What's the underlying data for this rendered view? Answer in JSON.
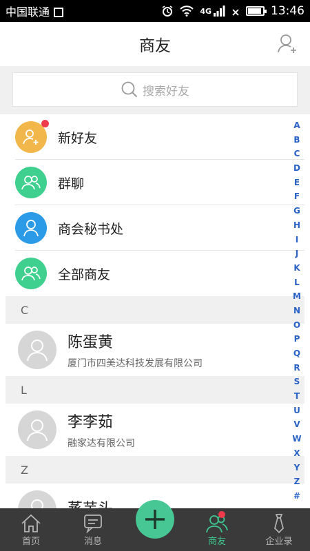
{
  "status_bar": {
    "carrier": "中国联通",
    "network": "4G",
    "time": "13:46"
  },
  "header": {
    "title": "商友"
  },
  "search": {
    "placeholder": "搜索好友"
  },
  "shortcuts": [
    {
      "label": "新好友",
      "color": "#f2b74a",
      "icon": "add-person-icon",
      "badge": true
    },
    {
      "label": "群聊",
      "color": "#3fd08f",
      "icon": "group-icon",
      "badge": false
    },
    {
      "label": "商会秘书处",
      "color": "#2b9be8",
      "icon": "person-icon",
      "badge": false
    },
    {
      "label": "全部商友",
      "color": "#3fd08f",
      "icon": "group-icon",
      "badge": false
    }
  ],
  "sections": [
    {
      "letter": "C",
      "contacts": [
        {
          "name": "陈蛋黄",
          "company": "厦门市四美达科技发展有限公司"
        }
      ]
    },
    {
      "letter": "L",
      "contacts": [
        {
          "name": "李李茹",
          "company": "融家达有限公司"
        }
      ]
    },
    {
      "letter": "Z",
      "contacts": [
        {
          "name": "蒸芋头",
          "company": ""
        }
      ]
    }
  ],
  "alphabet": [
    "A",
    "B",
    "C",
    "D",
    "E",
    "F",
    "G",
    "H",
    "I",
    "J",
    "K",
    "L",
    "M",
    "N",
    "O",
    "P",
    "Q",
    "R",
    "S",
    "T",
    "U",
    "V",
    "W",
    "X",
    "Y",
    "Z",
    "#"
  ],
  "bottom_nav": [
    {
      "label": "首页",
      "icon": "home-icon"
    },
    {
      "label": "消息",
      "icon": "message-icon"
    },
    {
      "label": "",
      "icon": "plus-icon"
    },
    {
      "label": "商友",
      "icon": "friends-icon"
    },
    {
      "label": "企业录",
      "icon": "tie-icon"
    }
  ],
  "colors": {
    "accent": "#3fc58f",
    "index": "#2a63c5",
    "badge": "#ee3b4b",
    "nav_bg": "#3a3a3a"
  }
}
